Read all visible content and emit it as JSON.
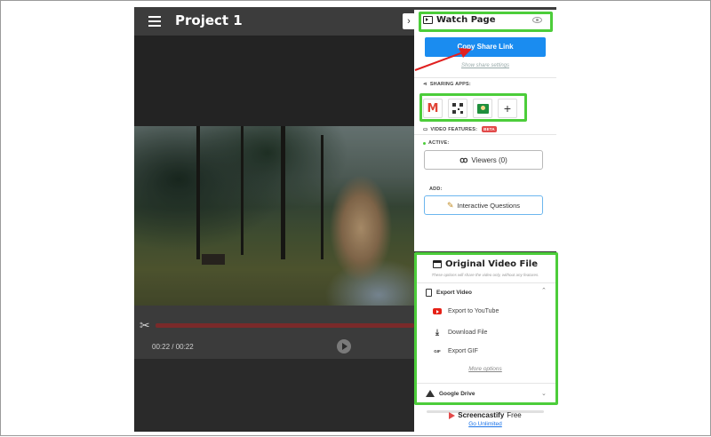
{
  "editor": {
    "project_title": "Project 1",
    "timecode": "00:22 / 00:22"
  },
  "panel": {
    "watch_page_title": "Watch Page",
    "copy_share_link": "Copy Share Link",
    "show_share_settings": "Show share settings",
    "sharing_apps_label": "SHARING APPS:",
    "video_features_label": "VIDEO FEATURES:",
    "beta_badge": "BETA",
    "active_label": "ACTIVE:",
    "viewers_button": "Viewers (0)",
    "add_label": "ADD:",
    "interactive_questions_button": "Interactive Questions",
    "original_video_file_title": "Original Video File",
    "original_video_file_sub": "These options will share the video only, without any features.",
    "export_video_label": "Export Video",
    "export_items": [
      "Export to YouTube",
      "Download File",
      "Export GIF"
    ],
    "gif_icon_text": "GIF",
    "more_options": "More options",
    "google_drive_label": "Google Drive",
    "brand_name": "Screencastify",
    "brand_tier": "Free",
    "go_unlimited": "Go Unlimited"
  },
  "colors": {
    "accent_blue": "#1a8cf0",
    "highlight_green": "#4ccd3a",
    "annotation_red": "#e02020",
    "youtube_red": "#e62117"
  },
  "icons": [
    "hamburger-icon",
    "tv-icon",
    "eye-icon",
    "share-icon",
    "gmail-icon",
    "qr-code-icon",
    "google-classroom-icon",
    "plus-icon",
    "video-camera-icon",
    "binoculars-icon",
    "pencil-icon",
    "clapperboard-icon",
    "document-icon",
    "youtube-icon",
    "download-icon",
    "gif-icon",
    "google-drive-icon",
    "chevron-up-icon",
    "chevron-down-icon",
    "scissors-icon",
    "play-icon"
  ]
}
